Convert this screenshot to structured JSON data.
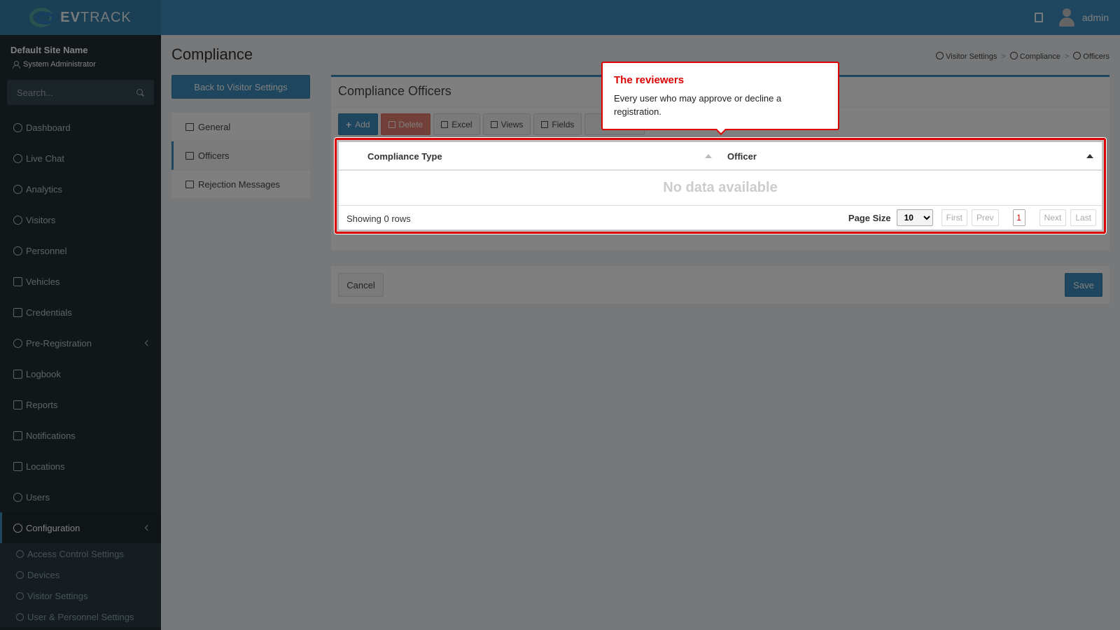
{
  "topbar": {
    "brand_bold": "EV",
    "brand_rest": "TRACK",
    "user_name": "admin"
  },
  "sidebar": {
    "site_name": "Default Site Name",
    "role": "System Administrator",
    "search_placeholder": "Search...",
    "items": [
      {
        "label": "Dashboard"
      },
      {
        "label": "Live Chat"
      },
      {
        "label": "Analytics"
      },
      {
        "label": "Visitors"
      },
      {
        "label": "Personnel"
      },
      {
        "label": "Vehicles"
      },
      {
        "label": "Credentials"
      },
      {
        "label": "Pre-Registration"
      },
      {
        "label": "Logbook"
      },
      {
        "label": "Reports"
      },
      {
        "label": "Notifications"
      },
      {
        "label": "Locations"
      },
      {
        "label": "Users"
      },
      {
        "label": "Configuration"
      }
    ],
    "subitems": [
      {
        "label": "Access Control Settings"
      },
      {
        "label": "Devices"
      },
      {
        "label": "Visitor Settings"
      },
      {
        "label": "User & Personnel Settings"
      }
    ]
  },
  "page": {
    "title": "Compliance",
    "breadcrumb": [
      "Visitor Settings",
      "Compliance",
      "Officers"
    ],
    "back_label": "Back to Visitor Settings",
    "subnav": [
      "General",
      "Officers",
      "Rejection Messages"
    ]
  },
  "box": {
    "title": "Compliance Officers",
    "toolbar": {
      "add": "Add",
      "delete": "Delete",
      "excel": "Excel",
      "views": "Views",
      "fields": "Fields"
    },
    "columns": [
      "Compliance Type",
      "Officer"
    ],
    "empty_text": "No data available",
    "rows_text": "Showing 0 rows",
    "page_size_label": "Page Size",
    "page_size": "10",
    "pager": {
      "first": "First",
      "prev": "Prev",
      "current": "1",
      "next": "Next",
      "last": "Last"
    }
  },
  "footer": {
    "cancel": "Cancel",
    "save": "Save"
  },
  "tooltip": {
    "title": "The reviewers",
    "body": "Every user who may approve or decline a registration."
  },
  "colors": {
    "accent": "#3c8dbc",
    "sidebar": "#222d32",
    "highlight": "#dd0000"
  }
}
